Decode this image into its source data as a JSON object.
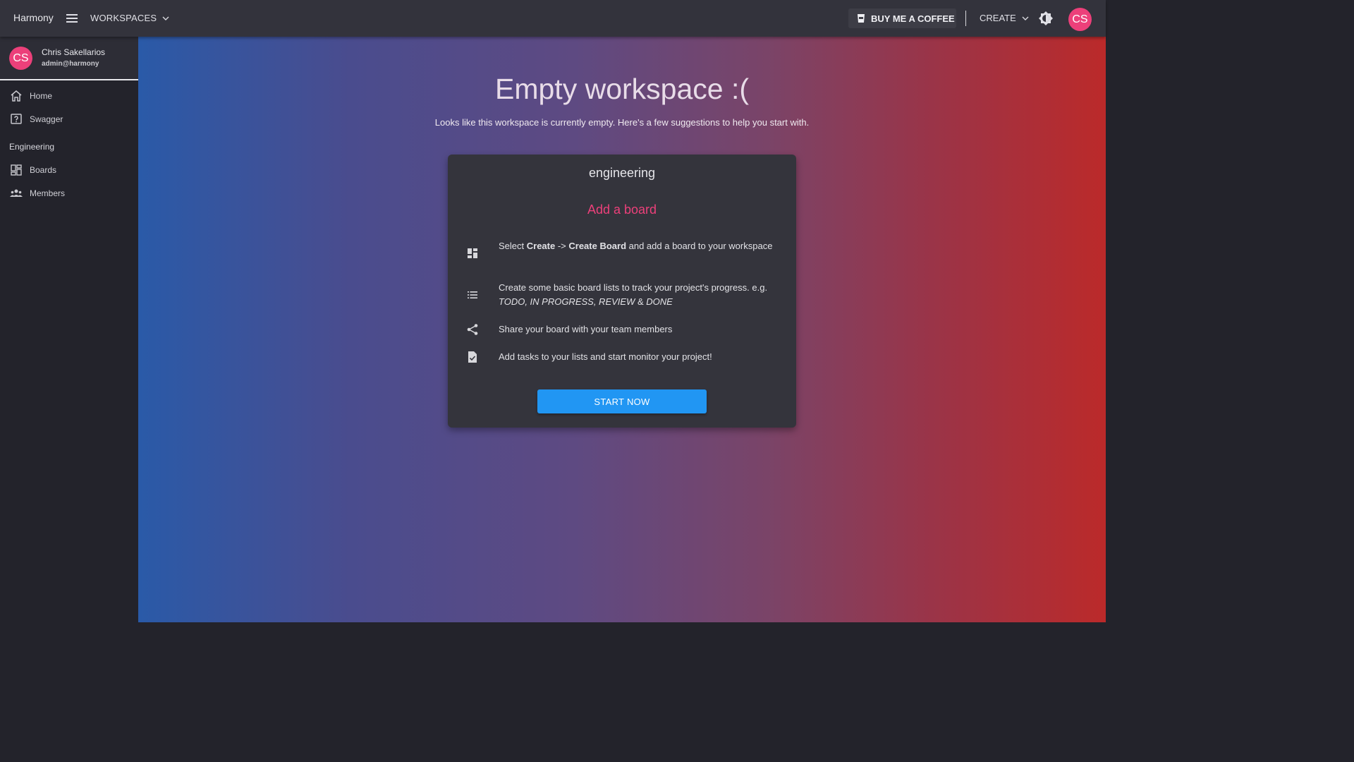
{
  "topbar": {
    "app_title": "Harmony",
    "workspaces_label": "WORKSPACES",
    "coffee_label": "BUY ME A COFFEE",
    "create_label": "CREATE",
    "avatar_initials": "CS"
  },
  "sidebar": {
    "user": {
      "initials": "CS",
      "name": "Chris Sakellarios",
      "email": "admin@harmony"
    },
    "items": [
      {
        "label": "Home",
        "icon": "home-icon"
      },
      {
        "label": "Swagger",
        "icon": "help-box-icon"
      }
    ],
    "section_title": "Engineering",
    "section_items": [
      {
        "label": "Boards",
        "icon": "dashboard-icon"
      },
      {
        "label": "Members",
        "icon": "people-icon"
      }
    ]
  },
  "main": {
    "headline": "Empty workspace :(",
    "subline": "Looks like this workspace is currently empty. Here's a few suggestions to help you start with.",
    "card": {
      "title": "engineering",
      "subtitle": "Add a board",
      "steps": [
        {
          "icon": "dashboard-icon",
          "pre": "Select ",
          "b1": "Create",
          "mid": " -> ",
          "b2": "Create Board",
          "post": " and add a board to your workspace"
        },
        {
          "icon": "list-icon",
          "pre": "Create some basic board lists to track your project's progress. e.g. ",
          "i1": "TODO, IN PROGRESS, REVIEW",
          "mid": " & ",
          "i2": "DONE"
        },
        {
          "icon": "share-icon",
          "text": "Share your board with your team members"
        },
        {
          "icon": "task-file-icon",
          "text": "Add tasks to your lists and start monitor your project!"
        }
      ],
      "button_label": "START NOW"
    }
  },
  "colors": {
    "accent_pink": "#ec407a",
    "button_blue": "#2196f3",
    "gradient_left": "#2a5aa8",
    "gradient_right": "#bb2a2a"
  }
}
